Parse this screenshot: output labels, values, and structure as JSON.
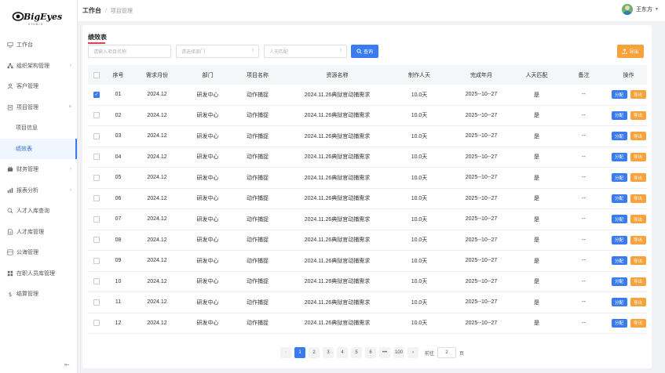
{
  "brand": {
    "logo_text": "BigEyes",
    "logo_sub": "STUDIO"
  },
  "header": {
    "breadcrumb_home": "工作台",
    "breadcrumb_sep": "/",
    "breadcrumb_current": "项目管理",
    "user_name": "王东方"
  },
  "sidebar": {
    "items": [
      {
        "label": "工作台",
        "icon": "monitor-icon",
        "chevron": ""
      },
      {
        "label": "组织架构管理",
        "icon": "org-icon",
        "chevron": "›"
      },
      {
        "label": "客户管理",
        "icon": "user-icon",
        "chevron": ""
      },
      {
        "label": "项目管理",
        "icon": "clipboard-icon",
        "chevron": "˄"
      },
      {
        "label": "项目信息",
        "icon": "",
        "chevron": ""
      },
      {
        "label": "绩效表",
        "icon": "",
        "chevron": ""
      },
      {
        "label": "财务管理",
        "icon": "finance-icon",
        "chevron": "›"
      },
      {
        "label": "报表分析",
        "icon": "chart-icon",
        "chevron": "›"
      },
      {
        "label": "人才入库查询",
        "icon": "search-icon",
        "chevron": ""
      },
      {
        "label": "人才库管理",
        "icon": "document-icon",
        "chevron": ""
      },
      {
        "label": "公海管理",
        "icon": "folder-icon",
        "chevron": ""
      },
      {
        "label": "在职人员库管理",
        "icon": "grid-icon",
        "chevron": ""
      },
      {
        "label": "结算管理",
        "icon": "dollar-icon",
        "chevron": ""
      }
    ],
    "active_index": 5
  },
  "main": {
    "title": "绩效表",
    "filters": {
      "project_placeholder": "请输入项目名称",
      "dept_placeholder": "请选择部门",
      "match_placeholder": "人天匹配"
    },
    "query_label": "查询",
    "export_label": "导出",
    "table": {
      "headers": [
        "序号",
        "需求月份",
        "部门",
        "项目名称",
        "资源名称",
        "制作人天",
        "完成年月",
        "人天匹配",
        "备注",
        "操作"
      ],
      "action_assign": "分配",
      "action_export": "导出",
      "rows": [
        {
          "checked": true,
          "cells": [
            "01",
            "2024.12",
            "研发中心",
            "动作捕捉",
            "2024.11.26典狱官动捕需求",
            "10.0天",
            "2025--10--27",
            "是",
            "--"
          ]
        },
        {
          "checked": false,
          "cells": [
            "02",
            "2024.12",
            "研发中心",
            "动作捕捉",
            "2024.11.26典狱官动捕需求",
            "10.0天",
            "2025--10--27",
            "是",
            "--"
          ]
        },
        {
          "checked": false,
          "cells": [
            "03",
            "2024.12",
            "研发中心",
            "动作捕捉",
            "2024.11.26典狱官动捕需求",
            "10.0天",
            "2025--10--27",
            "是",
            "--"
          ]
        },
        {
          "checked": false,
          "cells": [
            "04",
            "2024.12",
            "研发中心",
            "动作捕捉",
            "2024.11.26典狱官动捕需求",
            "10.0天",
            "2025--10--27",
            "是",
            "--"
          ]
        },
        {
          "checked": false,
          "cells": [
            "05",
            "2024.12",
            "研发中心",
            "动作捕捉",
            "2024.11.26典狱官动捕需求",
            "10.0天",
            "2025--10--27",
            "是",
            "--"
          ]
        },
        {
          "checked": false,
          "cells": [
            "06",
            "2024.12",
            "研发中心",
            "动作捕捉",
            "2024.11.26典狱官动捕需求",
            "10.0天",
            "2025--10--27",
            "是",
            "--"
          ]
        },
        {
          "checked": false,
          "cells": [
            "07",
            "2024.12",
            "研发中心",
            "动作捕捉",
            "2024.11.26典狱官动捕需求",
            "10.0天",
            "2025--10--27",
            "是",
            "--"
          ]
        },
        {
          "checked": false,
          "cells": [
            "08",
            "2024.12",
            "研发中心",
            "动作捕捉",
            "2024.11.26典狱官动捕需求",
            "10.0天",
            "2025--10--27",
            "是",
            "--"
          ]
        },
        {
          "checked": false,
          "cells": [
            "09",
            "2024.12",
            "研发中心",
            "动作捕捉",
            "2024.11.26典狱官动捕需求",
            "10.0天",
            "2025--10--27",
            "是",
            "--"
          ]
        },
        {
          "checked": false,
          "cells": [
            "10",
            "2024.12",
            "研发中心",
            "动作捕捉",
            "2024.11.26典狱官动捕需求",
            "10.0天",
            "2025--10--27",
            "是",
            "--"
          ]
        },
        {
          "checked": false,
          "cells": [
            "11",
            "2024.12",
            "研发中心",
            "动作捕捉",
            "2024.11.26典狱官动捕需求",
            "10.0天",
            "2025--10--27",
            "是",
            "--"
          ]
        },
        {
          "checked": false,
          "cells": [
            "12",
            "2024.12",
            "研发中心",
            "动作捕捉",
            "2024.11.26典狱官动捕需求",
            "10.0天",
            "2025--10--27",
            "是",
            "--"
          ]
        }
      ]
    },
    "pagination": {
      "prev": "‹",
      "pages": [
        "1",
        "2",
        "3",
        "4",
        "5",
        "6",
        "•••",
        "100"
      ],
      "current": "1",
      "next": "›",
      "goto_prefix": "前往",
      "goto_value": "2",
      "goto_suffix": "页"
    }
  },
  "colors": {
    "primary": "#3a7cf0",
    "warning": "#f7a23a",
    "title_underline": "#e0434f"
  }
}
